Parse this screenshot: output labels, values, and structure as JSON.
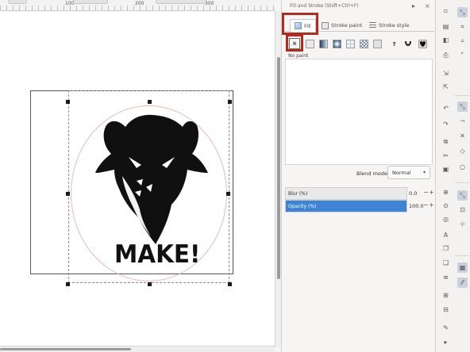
{
  "ruler": {
    "labels": [
      "100",
      "200",
      "300"
    ]
  },
  "canvas": {
    "logo_text": "MAKE!"
  },
  "dialog": {
    "title": "Fill and Stroke (Shift+Ctrl+F)",
    "tabs": [
      {
        "label": "Fill",
        "active": true
      },
      {
        "label": "Stroke paint",
        "active": false
      },
      {
        "label": "Stroke style",
        "active": false
      }
    ],
    "paint_buttons": [
      "no-paint",
      "flat-color",
      "linear-gradient",
      "radial-gradient",
      "mesh-gradient",
      "pattern",
      "swatch",
      "unset",
      "fill-rule-evenodd",
      "fill-rule-nonzero"
    ],
    "unset_glyph": "?",
    "x_glyph": "×",
    "paint_status": "No paint",
    "blend_mode": {
      "label": "Blend mode:",
      "value": "Normal",
      "arrow": "▾"
    },
    "blur": {
      "label": "Blur (%)",
      "value": "0.0",
      "fraction": 0.0
    },
    "opacity": {
      "label": "Opacity (%)",
      "value": "100.0",
      "fraction": 1.0
    },
    "minus": "−",
    "plus": "+"
  },
  "colors": {
    "accent": "#3d84d6",
    "highlight": "#b42a1f"
  }
}
